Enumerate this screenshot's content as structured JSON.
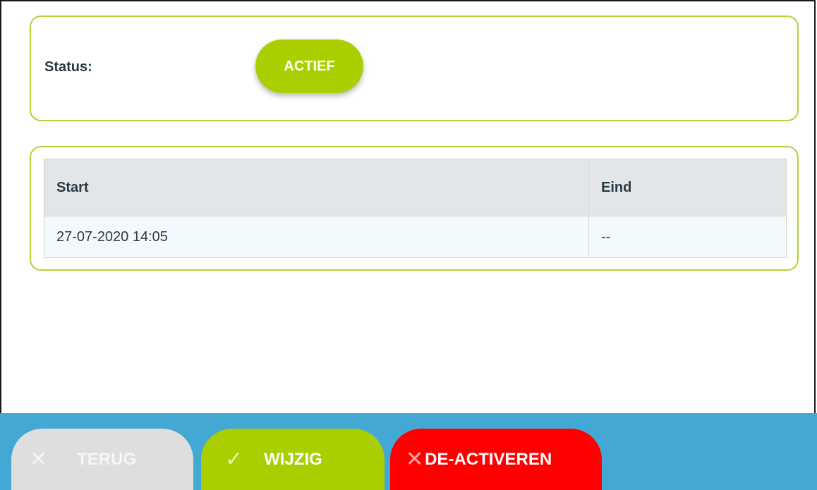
{
  "status": {
    "label": "Status:",
    "value": "ACTIEF"
  },
  "periods": {
    "columns": [
      "Start",
      "Eind"
    ],
    "rows": [
      [
        "27-07-2020 14:05",
        "--"
      ]
    ]
  },
  "actions": {
    "back": {
      "label": "TERUG",
      "icon": "close-icon"
    },
    "edit": {
      "label": "WIJZIG",
      "icon": "check-icon"
    },
    "deactivate": {
      "label": "DE-ACTIVEREN",
      "icon": "close-icon"
    }
  },
  "colors": {
    "accent_green": "#aacf00",
    "card_border": "#b3d23b",
    "bar_blue": "#43a8d3",
    "danger_red": "#ff0000",
    "disabled_gray": "#dedede"
  }
}
